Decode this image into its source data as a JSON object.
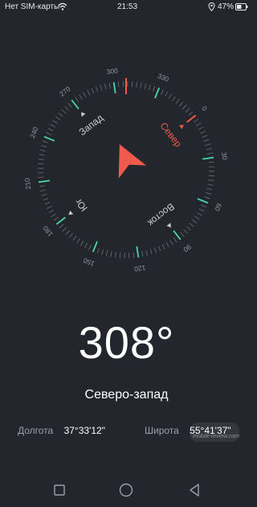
{
  "status_bar": {
    "carrier": "Нет SIM-карты",
    "time": "21:53",
    "battery": "47%"
  },
  "compass": {
    "heading": "308°",
    "heading_degrees": 308,
    "direction": "Северо-запад",
    "degree_labels": [
      "0",
      "30",
      "60",
      "90",
      "120",
      "150",
      "180",
      "210",
      "240",
      "270",
      "300",
      "330"
    ],
    "cardinals": {
      "north": "Север",
      "east": "Восток",
      "south": "Юг",
      "west": "Запад"
    },
    "colors": {
      "accent": "#f05a4a",
      "tick_highlight": "#4ad6a8",
      "tick": "#6b7078",
      "background": "#23262d"
    }
  },
  "coordinates": {
    "longitude_label": "Долгота",
    "longitude_value": "37°33'12\"",
    "latitude_label": "Широта",
    "latitude_value": "55°41'37\""
  },
  "watermark": "mobile-review.com",
  "nav": {
    "back_icon": "back-triangle-icon",
    "home_icon": "home-circle-icon",
    "recent_icon": "recent-square-icon"
  }
}
